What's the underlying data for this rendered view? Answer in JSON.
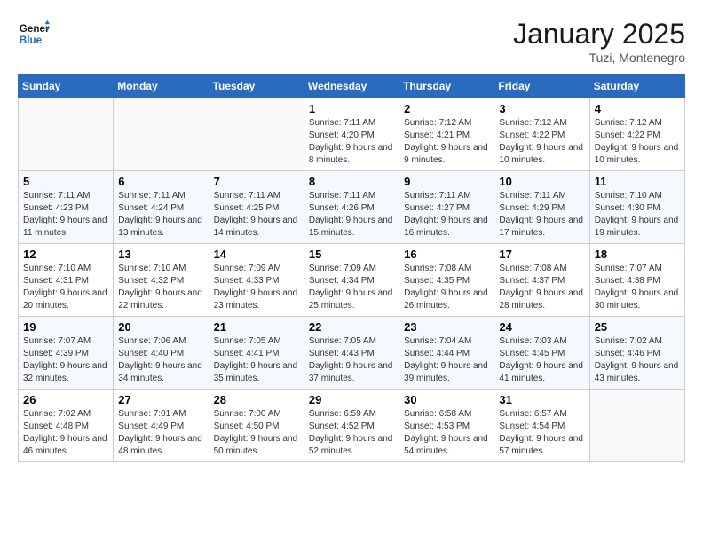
{
  "header": {
    "logo_line1": "General",
    "logo_line2": "Blue",
    "month_title": "January 2025",
    "location": "Tuzi, Montenegro"
  },
  "days_of_week": [
    "Sunday",
    "Monday",
    "Tuesday",
    "Wednesday",
    "Thursday",
    "Friday",
    "Saturday"
  ],
  "weeks": [
    [
      {
        "day": "",
        "info": ""
      },
      {
        "day": "",
        "info": ""
      },
      {
        "day": "",
        "info": ""
      },
      {
        "day": "1",
        "info": "Sunrise: 7:11 AM\nSunset: 4:20 PM\nDaylight: 9 hours and 8 minutes."
      },
      {
        "day": "2",
        "info": "Sunrise: 7:12 AM\nSunset: 4:21 PM\nDaylight: 9 hours and 9 minutes."
      },
      {
        "day": "3",
        "info": "Sunrise: 7:12 AM\nSunset: 4:22 PM\nDaylight: 9 hours and 10 minutes."
      },
      {
        "day": "4",
        "info": "Sunrise: 7:12 AM\nSunset: 4:22 PM\nDaylight: 9 hours and 10 minutes."
      }
    ],
    [
      {
        "day": "5",
        "info": "Sunrise: 7:11 AM\nSunset: 4:23 PM\nDaylight: 9 hours and 11 minutes."
      },
      {
        "day": "6",
        "info": "Sunrise: 7:11 AM\nSunset: 4:24 PM\nDaylight: 9 hours and 13 minutes."
      },
      {
        "day": "7",
        "info": "Sunrise: 7:11 AM\nSunset: 4:25 PM\nDaylight: 9 hours and 14 minutes."
      },
      {
        "day": "8",
        "info": "Sunrise: 7:11 AM\nSunset: 4:26 PM\nDaylight: 9 hours and 15 minutes."
      },
      {
        "day": "9",
        "info": "Sunrise: 7:11 AM\nSunset: 4:27 PM\nDaylight: 9 hours and 16 minutes."
      },
      {
        "day": "10",
        "info": "Sunrise: 7:11 AM\nSunset: 4:29 PM\nDaylight: 9 hours and 17 minutes."
      },
      {
        "day": "11",
        "info": "Sunrise: 7:10 AM\nSunset: 4:30 PM\nDaylight: 9 hours and 19 minutes."
      }
    ],
    [
      {
        "day": "12",
        "info": "Sunrise: 7:10 AM\nSunset: 4:31 PM\nDaylight: 9 hours and 20 minutes."
      },
      {
        "day": "13",
        "info": "Sunrise: 7:10 AM\nSunset: 4:32 PM\nDaylight: 9 hours and 22 minutes."
      },
      {
        "day": "14",
        "info": "Sunrise: 7:09 AM\nSunset: 4:33 PM\nDaylight: 9 hours and 23 minutes."
      },
      {
        "day": "15",
        "info": "Sunrise: 7:09 AM\nSunset: 4:34 PM\nDaylight: 9 hours and 25 minutes."
      },
      {
        "day": "16",
        "info": "Sunrise: 7:08 AM\nSunset: 4:35 PM\nDaylight: 9 hours and 26 minutes."
      },
      {
        "day": "17",
        "info": "Sunrise: 7:08 AM\nSunset: 4:37 PM\nDaylight: 9 hours and 28 minutes."
      },
      {
        "day": "18",
        "info": "Sunrise: 7:07 AM\nSunset: 4:38 PM\nDaylight: 9 hours and 30 minutes."
      }
    ],
    [
      {
        "day": "19",
        "info": "Sunrise: 7:07 AM\nSunset: 4:39 PM\nDaylight: 9 hours and 32 minutes."
      },
      {
        "day": "20",
        "info": "Sunrise: 7:06 AM\nSunset: 4:40 PM\nDaylight: 9 hours and 34 minutes."
      },
      {
        "day": "21",
        "info": "Sunrise: 7:05 AM\nSunset: 4:41 PM\nDaylight: 9 hours and 35 minutes."
      },
      {
        "day": "22",
        "info": "Sunrise: 7:05 AM\nSunset: 4:43 PM\nDaylight: 9 hours and 37 minutes."
      },
      {
        "day": "23",
        "info": "Sunrise: 7:04 AM\nSunset: 4:44 PM\nDaylight: 9 hours and 39 minutes."
      },
      {
        "day": "24",
        "info": "Sunrise: 7:03 AM\nSunset: 4:45 PM\nDaylight: 9 hours and 41 minutes."
      },
      {
        "day": "25",
        "info": "Sunrise: 7:02 AM\nSunset: 4:46 PM\nDaylight: 9 hours and 43 minutes."
      }
    ],
    [
      {
        "day": "26",
        "info": "Sunrise: 7:02 AM\nSunset: 4:48 PM\nDaylight: 9 hours and 46 minutes."
      },
      {
        "day": "27",
        "info": "Sunrise: 7:01 AM\nSunset: 4:49 PM\nDaylight: 9 hours and 48 minutes."
      },
      {
        "day": "28",
        "info": "Sunrise: 7:00 AM\nSunset: 4:50 PM\nDaylight: 9 hours and 50 minutes."
      },
      {
        "day": "29",
        "info": "Sunrise: 6:59 AM\nSunset: 4:52 PM\nDaylight: 9 hours and 52 minutes."
      },
      {
        "day": "30",
        "info": "Sunrise: 6:58 AM\nSunset: 4:53 PM\nDaylight: 9 hours and 54 minutes."
      },
      {
        "day": "31",
        "info": "Sunrise: 6:57 AM\nSunset: 4:54 PM\nDaylight: 9 hours and 57 minutes."
      },
      {
        "day": "",
        "info": ""
      }
    ]
  ]
}
